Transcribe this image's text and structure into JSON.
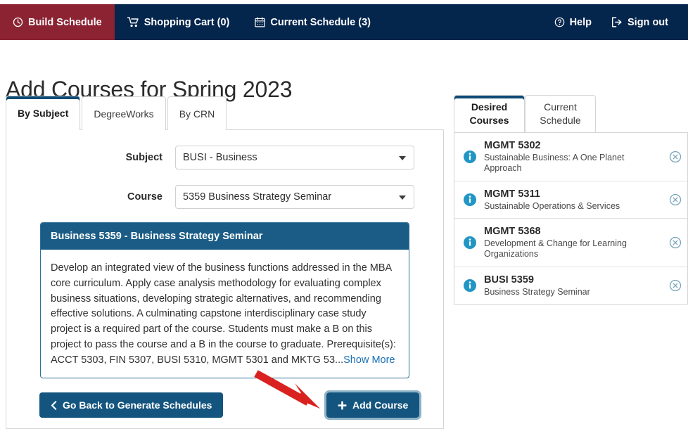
{
  "navbar": {
    "left_items": [
      {
        "label": "Build Schedule",
        "icon": "clock-icon",
        "active": true
      },
      {
        "label": "Shopping Cart (0)",
        "icon": "cart-icon",
        "active": false
      },
      {
        "label": "Current Schedule (3)",
        "icon": "calendar-icon",
        "active": false
      }
    ],
    "right_items": [
      {
        "label": "Help",
        "icon": "question-circle-icon"
      },
      {
        "label": "Sign out",
        "icon": "sign-out-icon"
      }
    ],
    "bg_color": "#04254c",
    "active_color": "#8b2332"
  },
  "page": {
    "title": "Add Courses for Spring 2023"
  },
  "tabs": [
    {
      "label": "By Subject",
      "active": true
    },
    {
      "label": "DegreeWorks",
      "active": false
    },
    {
      "label": "By CRN",
      "active": false
    }
  ],
  "form": {
    "subject": {
      "label": "Subject",
      "value": "BUSI - Business"
    },
    "course": {
      "label": "Course",
      "value": "5359 Business Strategy Seminar"
    }
  },
  "course_card": {
    "header": "Business 5359 - Business Strategy Seminar",
    "description": "Develop an integrated view of the business functions addressed in the MBA core curriculum. Apply case analysis methodology for evaluating complex business situations, developing strategic alternatives, and recommending effective solutions. A culminating capstone interdisciplinary case study project is a required part of the course. Students must make a B on this project to pass the course and a B in the course to graduate. Prerequisite(s): ACCT 5303, FIN 5307, BUSI 5310, MGMT 5301 and MKTG 53...",
    "show_more": "Show More",
    "header_color": "#1a5c85"
  },
  "buttons": {
    "back": "Go Back to Generate Schedules",
    "back_icon": "chevron-left-icon",
    "add": "Add Course",
    "add_icon": "plus-icon",
    "color": "#14557f"
  },
  "sidebar": {
    "tabs": [
      {
        "line1": "Desired",
        "line2": "Courses",
        "active": true
      },
      {
        "line1": "Current",
        "line2": "Schedule",
        "active": false
      }
    ],
    "courses": [
      {
        "code": "MGMT 5302",
        "name": "Sustainable Business: A One Planet Approach"
      },
      {
        "code": "MGMT 5311",
        "name": "Sustainable Operations & Services"
      },
      {
        "code": "MGMT 5368",
        "name": "Development & Change for Learning Organizations"
      },
      {
        "code": "BUSI 5359",
        "name": "Business Strategy Seminar"
      }
    ],
    "info_icon": "info-circle-icon",
    "remove_icon": "remove-circle-icon",
    "info_color": "#2196c4",
    "remove_color": "#7ba7bd"
  },
  "annotation": {
    "arrow_color": "#d9221f",
    "arrow_name": "red-arrow-pointing-to-add-course"
  }
}
